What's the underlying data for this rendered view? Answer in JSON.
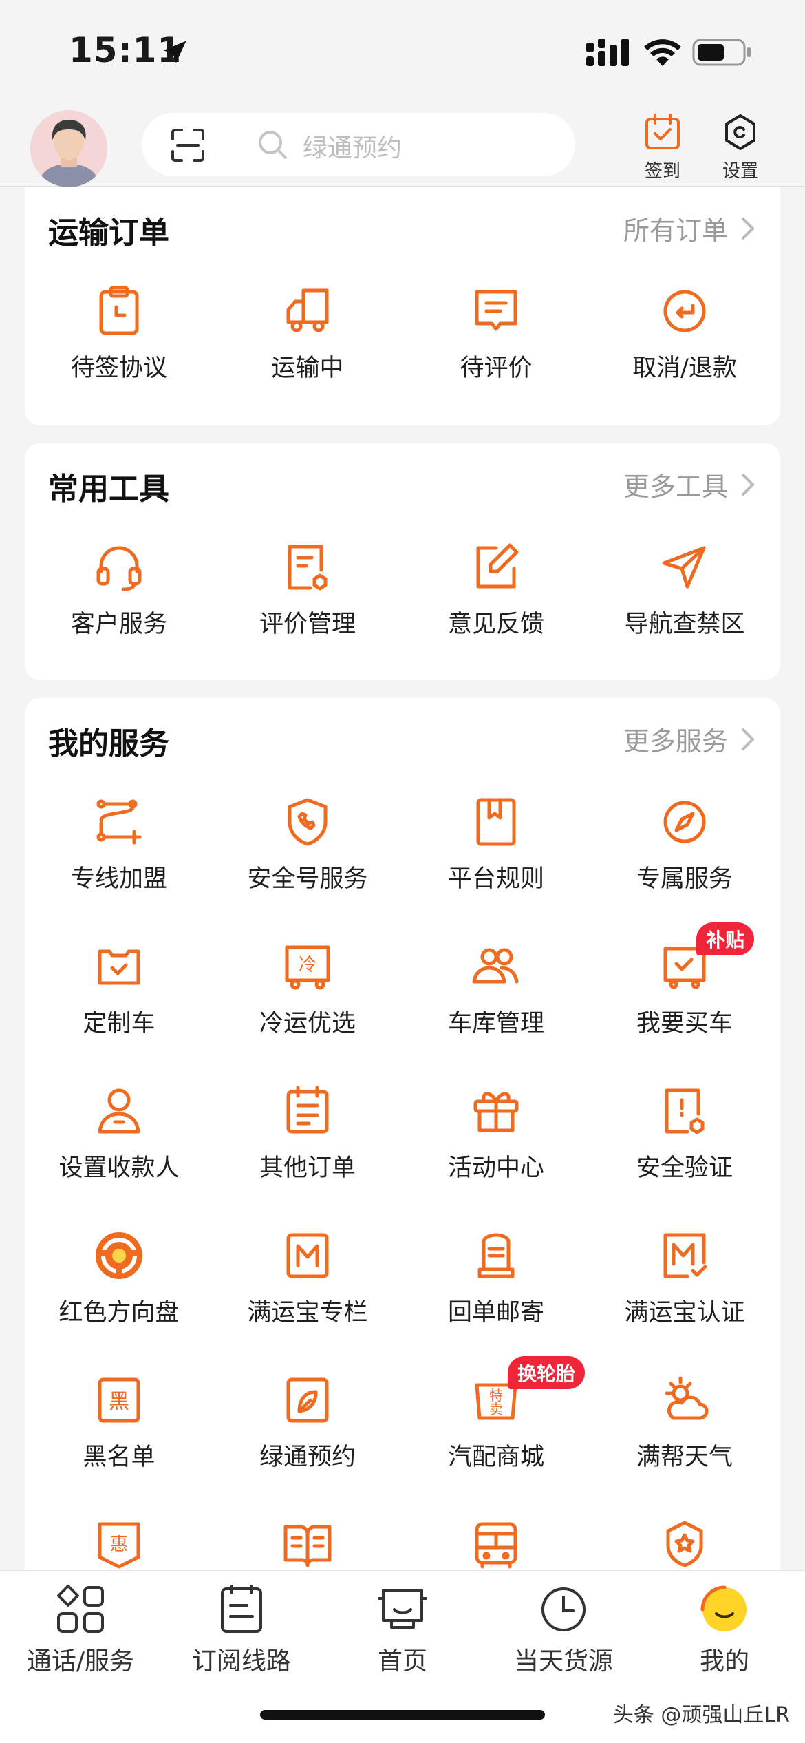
{
  "status": {
    "time": "15:11"
  },
  "header": {
    "search_placeholder": "绿通预约",
    "signin_label": "签到",
    "settings_label": "设置"
  },
  "transport": {
    "title": "运输订单",
    "more": "所有订单",
    "items": [
      {
        "label": "待签协议",
        "icon": "contract-icon"
      },
      {
        "label": "运输中",
        "icon": "truck-icon"
      },
      {
        "label": "待评价",
        "icon": "review-icon"
      },
      {
        "label": "取消/退款",
        "icon": "refund-icon"
      }
    ]
  },
  "tools": {
    "title": "常用工具",
    "more": "更多工具",
    "items": [
      {
        "label": "客户服务",
        "icon": "headset-icon"
      },
      {
        "label": "评价管理",
        "icon": "review-manage-icon"
      },
      {
        "label": "意见反馈",
        "icon": "edit-icon"
      },
      {
        "label": "导航查禁区",
        "icon": "navigation-icon"
      }
    ]
  },
  "services": {
    "title": "我的服务",
    "more": "更多服务",
    "items": [
      {
        "label": "专线加盟",
        "icon": "route-icon"
      },
      {
        "label": "安全号服务",
        "icon": "shield-phone-icon"
      },
      {
        "label": "平台规则",
        "icon": "rulebook-icon"
      },
      {
        "label": "专属服务",
        "icon": "compass-icon"
      },
      {
        "label": "定制车",
        "icon": "custom-truck-icon"
      },
      {
        "label": "冷运优选",
        "icon": "cold-truck-icon"
      },
      {
        "label": "车库管理",
        "icon": "users-icon"
      },
      {
        "label": "我要买车",
        "icon": "buy-truck-icon",
        "badge": "补贴"
      },
      {
        "label": "设置收款人",
        "icon": "payee-icon"
      },
      {
        "label": "其他订单",
        "icon": "calendar-list-icon"
      },
      {
        "label": "活动中心",
        "icon": "gift-icon"
      },
      {
        "label": "安全验证",
        "icon": "security-verify-icon"
      },
      {
        "label": "红色方向盘",
        "icon": "steering-wheel-icon"
      },
      {
        "label": "满运宝专栏",
        "icon": "m-column-icon"
      },
      {
        "label": "回单邮寄",
        "icon": "mailbox-icon"
      },
      {
        "label": "满运宝认证",
        "icon": "m-verify-icon"
      },
      {
        "label": "黑名单",
        "icon": "blacklist-icon"
      },
      {
        "label": "绿通预约",
        "icon": "leaf-icon"
      },
      {
        "label": "汽配商城",
        "icon": "parts-shop-icon",
        "badge": "换轮胎"
      },
      {
        "label": "满帮天气",
        "icon": "weather-icon"
      },
      {
        "label": "",
        "icon": "discount-icon"
      },
      {
        "label": "",
        "icon": "book-icon"
      },
      {
        "label": "",
        "icon": "bus-icon"
      },
      {
        "label": "",
        "icon": "medal-icon"
      }
    ]
  },
  "tabbar": {
    "items": [
      {
        "label": "通话/服务",
        "icon": "grid-icon"
      },
      {
        "label": "订阅线路",
        "icon": "subscribe-icon"
      },
      {
        "label": "首页",
        "icon": "home-icon"
      },
      {
        "label": "当天货源",
        "icon": "clock-icon"
      },
      {
        "label": "我的",
        "icon": "profile-icon"
      }
    ]
  },
  "watermark": "头条 @顽强山丘LR",
  "colors": {
    "accent": "#f06a1f",
    "badge": "#f1253a",
    "background": "#f4f4f5"
  }
}
